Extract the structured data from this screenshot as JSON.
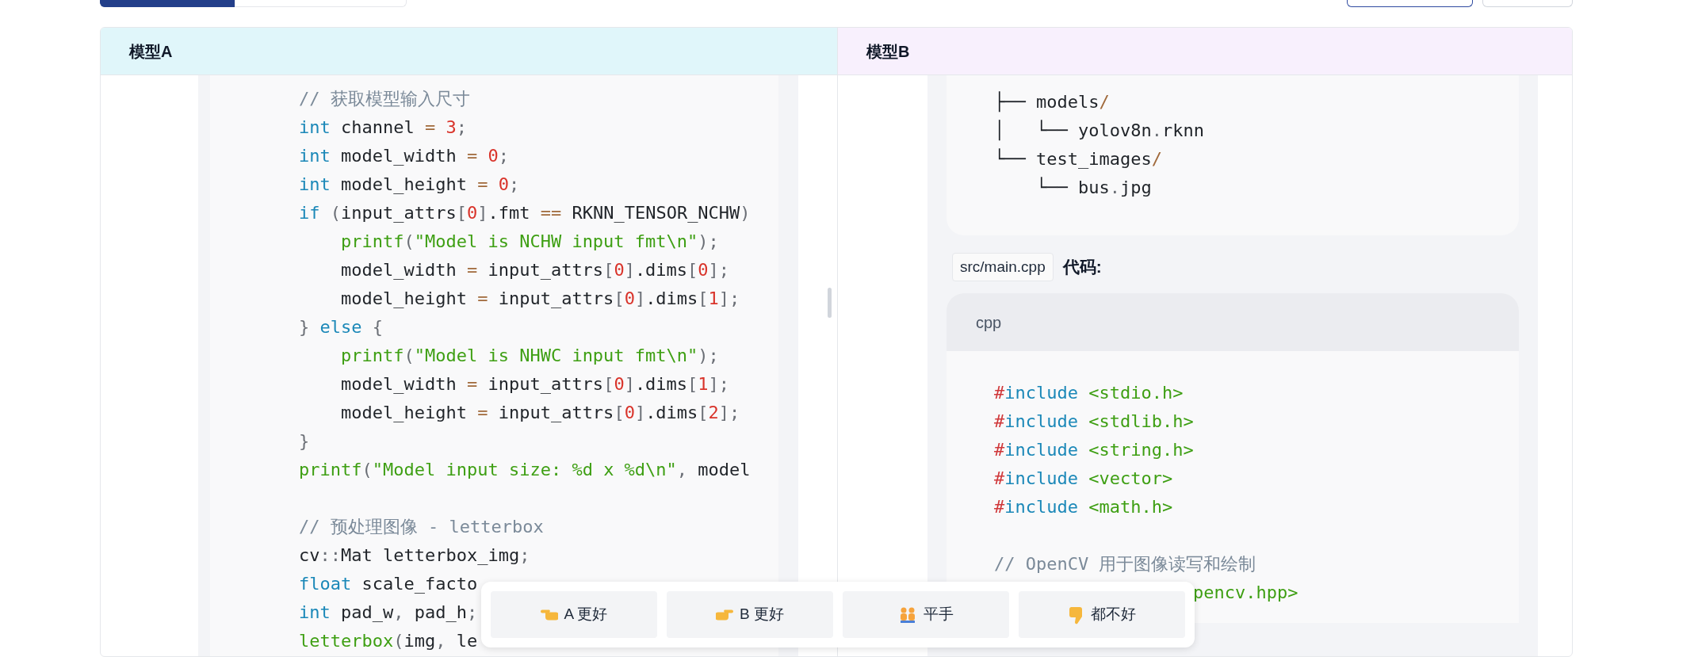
{
  "tabs": [
    {
      "selected": true
    },
    {
      "selected": false
    }
  ],
  "panels": [
    {
      "title": "模型A"
    },
    {
      "title": "模型B"
    }
  ],
  "left_code": [
    {
      "kind": "line",
      "tokens": [
        {
          "text": "// 获取模型输入尺寸",
          "kind": "cm"
        }
      ]
    },
    {
      "kind": "line",
      "tokens": [
        {
          "text": "int",
          "kind": "kw"
        },
        {
          "text": " channel ",
          "kind": "plain"
        },
        {
          "text": "=",
          "kind": "op"
        },
        {
          "text": " 3",
          "kind": "num"
        },
        {
          "text": ";",
          "kind": "punct"
        }
      ]
    },
    {
      "kind": "line",
      "tokens": [
        {
          "text": "int",
          "kind": "kw"
        },
        {
          "text": " model_width ",
          "kind": "plain"
        },
        {
          "text": "=",
          "kind": "op"
        },
        {
          "text": " 0",
          "kind": "num"
        },
        {
          "text": ";",
          "kind": "punct"
        }
      ]
    },
    {
      "kind": "line",
      "tokens": [
        {
          "text": "int",
          "kind": "kw"
        },
        {
          "text": " model_height ",
          "kind": "plain"
        },
        {
          "text": "=",
          "kind": "op"
        },
        {
          "text": " 0",
          "kind": "num"
        },
        {
          "text": ";",
          "kind": "punct"
        }
      ]
    },
    {
      "kind": "line",
      "tokens": [
        {
          "text": "if",
          "kind": "kw"
        },
        {
          "text": " (",
          "kind": "punct"
        },
        {
          "text": "input_attrs",
          "kind": "plain"
        },
        {
          "text": "[",
          "kind": "punct"
        },
        {
          "text": "0",
          "kind": "num"
        },
        {
          "text": "]",
          "kind": "punct"
        },
        {
          "text": ".fmt ",
          "kind": "plain"
        },
        {
          "text": "==",
          "kind": "op"
        },
        {
          "text": " RKNN_TENSOR_NCHW",
          "kind": "plain"
        },
        {
          "text": ")",
          "kind": "punct"
        }
      ]
    },
    {
      "kind": "line",
      "tokens": [
        {
          "text": "    printf",
          "kind": "str"
        },
        {
          "text": "(",
          "kind": "punct"
        },
        {
          "text": "\"Model is NCHW input fmt\\n\"",
          "kind": "str"
        },
        {
          "text": ");",
          "kind": "punct"
        }
      ]
    },
    {
      "kind": "line",
      "tokens": [
        {
          "text": "    model_width ",
          "kind": "plain"
        },
        {
          "text": "=",
          "kind": "op"
        },
        {
          "text": " input_attrs",
          "kind": "plain"
        },
        {
          "text": "[",
          "kind": "punct"
        },
        {
          "text": "0",
          "kind": "num"
        },
        {
          "text": "]",
          "kind": "punct"
        },
        {
          "text": ".dims",
          "kind": "plain"
        },
        {
          "text": "[",
          "kind": "punct"
        },
        {
          "text": "0",
          "kind": "num"
        },
        {
          "text": "];",
          "kind": "punct"
        }
      ]
    },
    {
      "kind": "line",
      "tokens": [
        {
          "text": "    model_height ",
          "kind": "plain"
        },
        {
          "text": "=",
          "kind": "op"
        },
        {
          "text": " input_attrs",
          "kind": "plain"
        },
        {
          "text": "[",
          "kind": "punct"
        },
        {
          "text": "0",
          "kind": "num"
        },
        {
          "text": "]",
          "kind": "punct"
        },
        {
          "text": ".dims",
          "kind": "plain"
        },
        {
          "text": "[",
          "kind": "punct"
        },
        {
          "text": "1",
          "kind": "num"
        },
        {
          "text": "];",
          "kind": "punct"
        }
      ]
    },
    {
      "kind": "line",
      "tokens": [
        {
          "text": "}",
          "kind": "punct"
        },
        {
          "text": " else",
          "kind": "kw"
        },
        {
          "text": " {",
          "kind": "punct"
        }
      ]
    },
    {
      "kind": "line",
      "tokens": [
        {
          "text": "    printf",
          "kind": "str"
        },
        {
          "text": "(",
          "kind": "punct"
        },
        {
          "text": "\"Model is NHWC input fmt\\n\"",
          "kind": "str"
        },
        {
          "text": ");",
          "kind": "punct"
        }
      ]
    },
    {
      "kind": "line",
      "tokens": [
        {
          "text": "    model_width ",
          "kind": "plain"
        },
        {
          "text": "=",
          "kind": "op"
        },
        {
          "text": " input_attrs",
          "kind": "plain"
        },
        {
          "text": "[",
          "kind": "punct"
        },
        {
          "text": "0",
          "kind": "num"
        },
        {
          "text": "]",
          "kind": "punct"
        },
        {
          "text": ".dims",
          "kind": "plain"
        },
        {
          "text": "[",
          "kind": "punct"
        },
        {
          "text": "1",
          "kind": "num"
        },
        {
          "text": "];",
          "kind": "punct"
        }
      ]
    },
    {
      "kind": "line",
      "tokens": [
        {
          "text": "    model_height ",
          "kind": "plain"
        },
        {
          "text": "=",
          "kind": "op"
        },
        {
          "text": " input_attrs",
          "kind": "plain"
        },
        {
          "text": "[",
          "kind": "punct"
        },
        {
          "text": "0",
          "kind": "num"
        },
        {
          "text": "]",
          "kind": "punct"
        },
        {
          "text": ".dims",
          "kind": "plain"
        },
        {
          "text": "[",
          "kind": "punct"
        },
        {
          "text": "2",
          "kind": "num"
        },
        {
          "text": "];",
          "kind": "punct"
        }
      ]
    },
    {
      "kind": "line",
      "tokens": [
        {
          "text": "}",
          "kind": "punct"
        }
      ]
    },
    {
      "kind": "line",
      "tokens": [
        {
          "text": "printf",
          "kind": "str"
        },
        {
          "text": "(",
          "kind": "punct"
        },
        {
          "text": "\"Model input size: %d x %d\\n\"",
          "kind": "str"
        },
        {
          "text": ",",
          "kind": "punct"
        },
        {
          "text": " model",
          "kind": "plain"
        }
      ]
    },
    {
      "kind": "blank"
    },
    {
      "kind": "line",
      "tokens": [
        {
          "text": "// 预处理图像 - letterbox",
          "kind": "cm"
        }
      ]
    },
    {
      "kind": "line",
      "tokens": [
        {
          "text": "cv",
          "kind": "plain"
        },
        {
          "text": "::",
          "kind": "punct"
        },
        {
          "text": "Mat letterbox_img",
          "kind": "plain"
        },
        {
          "text": ";",
          "kind": "punct"
        }
      ]
    },
    {
      "kind": "line",
      "tokens": [
        {
          "text": "float",
          "kind": "kw"
        },
        {
          "text": " scale_facto",
          "kind": "plain"
        }
      ]
    },
    {
      "kind": "line",
      "tokens": [
        {
          "text": "int",
          "kind": "kw"
        },
        {
          "text": " pad_w",
          "kind": "plain"
        },
        {
          "text": ",",
          "kind": "punct"
        },
        {
          "text": " pad_h",
          "kind": "plain"
        },
        {
          "text": ";",
          "kind": "punct"
        }
      ]
    },
    {
      "kind": "line",
      "tokens": [
        {
          "text": "letterbox",
          "kind": "str"
        },
        {
          "text": "(",
          "kind": "punct"
        },
        {
          "text": "img",
          "kind": "plain"
        },
        {
          "text": ",",
          "kind": "punct"
        },
        {
          "text": " le",
          "kind": "plain"
        }
      ]
    }
  ],
  "tree": [
    {
      "kind": "line",
      "tokens": [
        {
          "text": "├── models",
          "kind": "plain"
        },
        {
          "text": "/",
          "kind": "op"
        }
      ]
    },
    {
      "kind": "line",
      "tokens": [
        {
          "text": "│   └── yolov8n",
          "kind": "plain"
        },
        {
          "text": ".",
          "kind": "punct"
        },
        {
          "text": "rknn",
          "kind": "plain"
        }
      ]
    },
    {
      "kind": "line",
      "tokens": [
        {
          "text": "└── test_images",
          "kind": "plain"
        },
        {
          "text": "/",
          "kind": "op"
        }
      ]
    },
    {
      "kind": "line",
      "tokens": [
        {
          "text": "    └── bus",
          "kind": "plain"
        },
        {
          "text": ".",
          "kind": "punct"
        },
        {
          "text": "jpg",
          "kind": "plain"
        }
      ]
    }
  ],
  "file_badge": "src/main.cpp",
  "file_label": "代码:",
  "code_lang": "cpp",
  "right_code": [
    {
      "kind": "line",
      "tokens": [
        {
          "text": "#",
          "kind": "pp"
        },
        {
          "text": "include",
          "kind": "kw"
        },
        {
          "text": " <stdio.h>",
          "kind": "str"
        }
      ]
    },
    {
      "kind": "line",
      "tokens": [
        {
          "text": "#",
          "kind": "pp"
        },
        {
          "text": "include",
          "kind": "kw"
        },
        {
          "text": " <stdlib.h>",
          "kind": "str"
        }
      ]
    },
    {
      "kind": "line",
      "tokens": [
        {
          "text": "#",
          "kind": "pp"
        },
        {
          "text": "include",
          "kind": "kw"
        },
        {
          "text": " <string.h>",
          "kind": "str"
        }
      ]
    },
    {
      "kind": "line",
      "tokens": [
        {
          "text": "#",
          "kind": "pp"
        },
        {
          "text": "include",
          "kind": "kw"
        },
        {
          "text": " <vector>",
          "kind": "str"
        }
      ]
    },
    {
      "kind": "line",
      "tokens": [
        {
          "text": "#",
          "kind": "pp"
        },
        {
          "text": "include",
          "kind": "kw"
        },
        {
          "text": " <math.h>",
          "kind": "str"
        }
      ]
    },
    {
      "kind": "blank"
    },
    {
      "kind": "line",
      "tokens": [
        {
          "text": "// OpenCV 用于图像读写和绘制",
          "kind": "cm"
        }
      ]
    },
    {
      "kind": "tail",
      "tokens": [
        {
          "text": "pencv.hpp>",
          "kind": "str"
        }
      ]
    }
  ],
  "votes": [
    {
      "label": "A 更好"
    },
    {
      "label": "B 更好"
    },
    {
      "label": "平手"
    },
    {
      "label": "都不好"
    }
  ]
}
